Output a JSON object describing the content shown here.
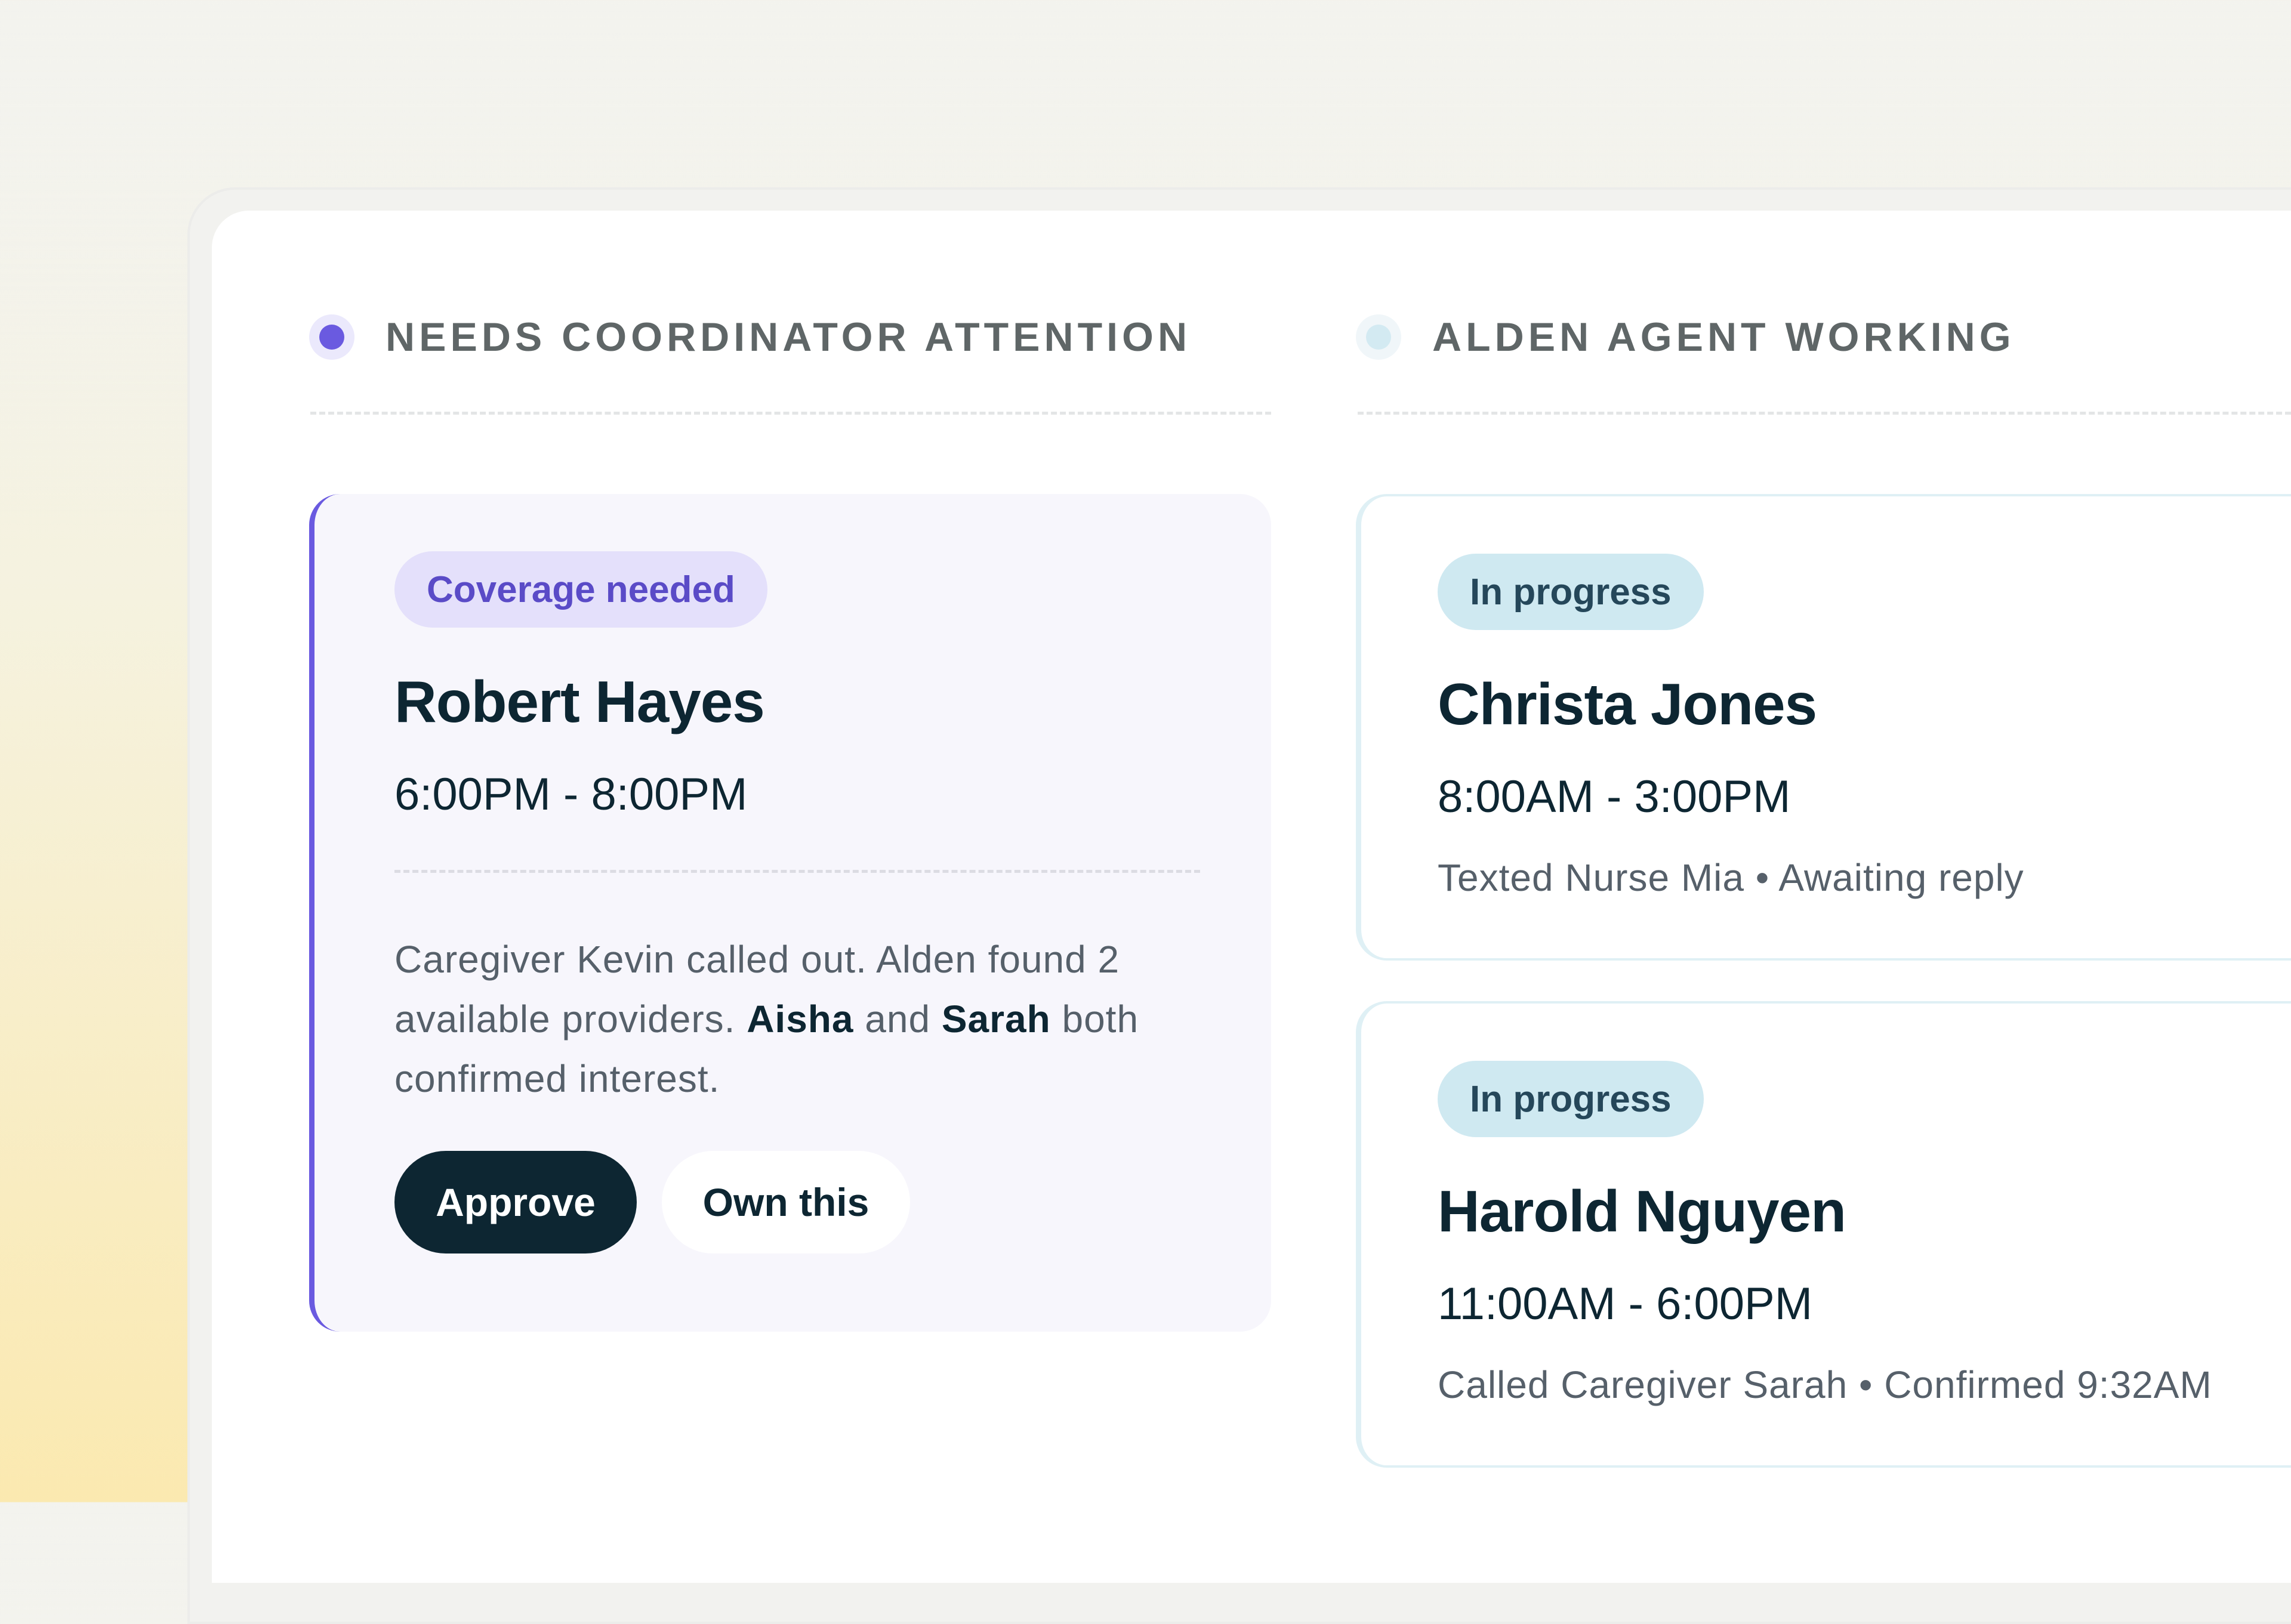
{
  "columns": {
    "attention": {
      "title": "NEEDS COORDINATOR ATTENTION",
      "accent_color": "#6a5ae0",
      "card": {
        "badge": "Coverage needed",
        "name": "Robert Hayes",
        "time": "6:00PM - 8:00PM",
        "description": {
          "part1": "Caregiver Kevin called out. Alden found 2 available providers. ",
          "highlight1": "Aisha",
          "part2": " and ",
          "highlight2": "Sarah",
          "part3": " both confirmed interest."
        },
        "approve_label": "Approve",
        "own_label": "Own this"
      }
    },
    "working": {
      "title": "ALDEN AGENT WORKING",
      "accent_color": "#d3eaf2",
      "cards": [
        {
          "badge": "In progress",
          "name": "Christa Jones",
          "time": "8:00AM - 3:00PM",
          "status": "Texted Nurse Mia • Awaiting reply"
        },
        {
          "badge": "In progress",
          "name": "Harold Nguyen",
          "time": "11:00AM - 6:00PM",
          "status": "Called Caregiver Sarah • Confirmed 9:32AM"
        }
      ]
    }
  }
}
